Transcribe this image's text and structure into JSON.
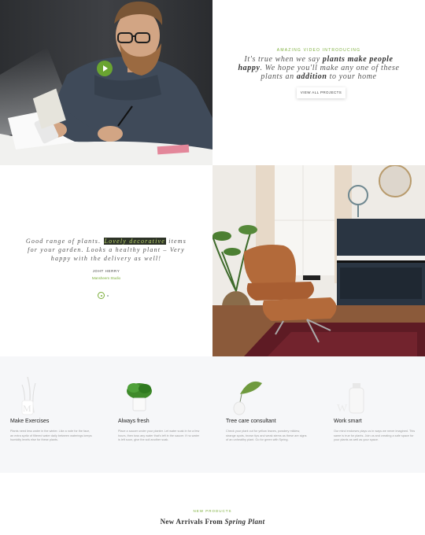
{
  "hero": {
    "play_icon": "play-icon"
  },
  "intro": {
    "kicker": "AMAZING VIDEO INTRODUCING",
    "quote_part1": "It's true when we say ",
    "quote_bold1": "plants make people happy",
    "quote_part2": ". We hope you'll make any one of these plants an ",
    "quote_bold2": "addition",
    "quote_part3": " to your home",
    "button_label": "VIEW ALL PROJECTS"
  },
  "testimonial": {
    "quote_part1": "Good range of plants. ",
    "quote_highlight": "Lovely decorative",
    "quote_part2": " items for your garden. Looks a healthy plant – Very happy with the delivery as well!",
    "author": "JOHT HERRY",
    "company": "Mansheem Studio"
  },
  "features": [
    {
      "title": "Make Exercises",
      "text": "Plants need less water in the winter. Like a note for the face, an extra spritz of filtered water daily between waterings keeps humidity levels else for these plants.",
      "icon": "vase-icon"
    },
    {
      "title": "Always fresh",
      "text": "Place a saucer under your planter. Let water soak in for a few hours, then toss any water that's left in the saucer. If no water is left soon, give the soil another soak.",
      "icon": "potted-plant-icon"
    },
    {
      "title": "Tree care consultant",
      "text": "Check your plant out for yellow leaves, powdery mildew, strange spots, brown tips and weak stems as these are signs of an unhealthy plant. Go for green with Spring.",
      "icon": "leaf-vase-icon"
    },
    {
      "title": "Work smart",
      "text": "Our mind endorses plays us in ways we never imagined. This same is true for plants. Join us and creating a safe space for your plants as well as your space.",
      "icon": "bottle-icon"
    }
  ],
  "arrivals": {
    "kicker": "NEW PRODUCTS",
    "title_plain": "New Arrivals From ",
    "title_em": "Spring Plant"
  },
  "colors": {
    "accent": "#7cae3b",
    "play_button": "#6aa431",
    "features_bg": "#f6f7f9"
  }
}
